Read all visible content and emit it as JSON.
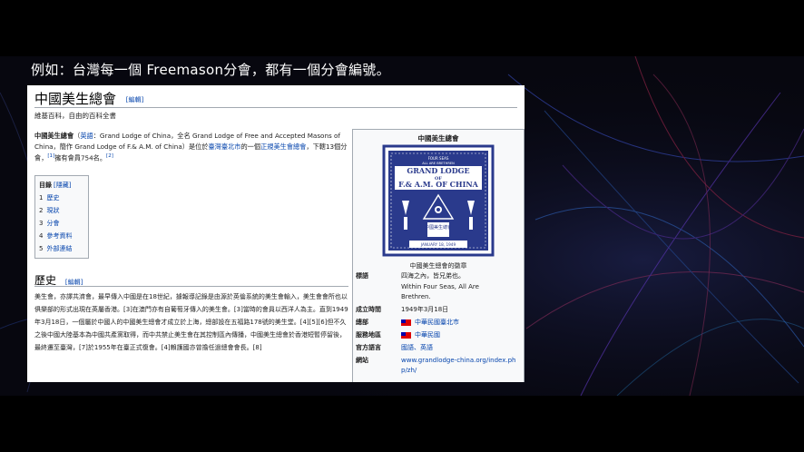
{
  "slide": {
    "caption": "例如：台灣每一個 Freemason分會，都有一個分會編號。"
  },
  "article": {
    "title": "中國美生總會",
    "title_edit": "[編輯]",
    "from": "維基百科，自由的百科全書",
    "intro_bold": "中國美生總會",
    "intro_parts": [
      "（",
      "英語",
      "：Grand Lodge of China，全名 Grand Lodge of Free and Accepted Masons of China，簡作 Grand Lodge of F.& A.M. of China）是位於",
      "臺灣臺北市",
      "的一個",
      "正規美生會總會",
      "，下轄13個分會，",
      "[1]",
      "擁有會員754名。",
      "[2]"
    ],
    "toc": {
      "title": "目錄",
      "hide": "[隱藏]",
      "items": [
        {
          "num": "1",
          "label": "歷史"
        },
        {
          "num": "2",
          "label": "現狀"
        },
        {
          "num": "3",
          "label": "分會"
        },
        {
          "num": "4",
          "label": "參考資料"
        },
        {
          "num": "5",
          "label": "外部連結"
        }
      ]
    },
    "history_heading": "歷史",
    "history_edit": "[編輯]",
    "history_text": "美生會，亦譯共濟會，最早傳入中國是在18世紀，據報導記錄是由源於英倫系統的美生會輸入，美生會會所也以俱樂部的形式出現在英屬香港。[3]在澳門亦有自葡萄牙傳入的美生會。[3]當時的會員以西洋人為主。直到1949年3月18日，一個屬於中國人的中國美生總會才成立於上海，總部設在五福路178號的美生堂。[4][5][6]但不久之後中國大陸基本為中國共產黨取得，而中共禁止美生會在其控制區內傳播，中國美生總會於香港短暫停留後，最終遷至臺灣，[7]於1955年在臺正式復會。[4]賴護國亦曾擔任過總會會長。[8]"
  },
  "infobox": {
    "caption": "中國美生總會",
    "emblem": {
      "top_text": "FOUR SEAS",
      "top_text2": "ALL ARE BRETHREN",
      "main1": "GRAND LODGE",
      "main2": "OF",
      "main3": "F.& A.M. OF CHINA",
      "chinese": "中國美生總會",
      "date": "JANUARY 18, 1949"
    },
    "emblem_caption": "中國美生總會的徽章",
    "rows": [
      {
        "key": "標語",
        "value": "四海之內，皆兄弟也。"
      },
      {
        "key": "",
        "value": "Within Four Seas, All Are Brethren."
      },
      {
        "key": "成立時間",
        "value": "1949年3月18日"
      },
      {
        "key": "總部",
        "value": "中華民國臺北市"
      },
      {
        "key": "服務地區",
        "value": "中華民國"
      },
      {
        "key": "官方語言",
        "value": "國語、英語"
      },
      {
        "key": "網站",
        "value": "www.grandlodge-china.org/index.php/zh/"
      }
    ]
  },
  "colors": {
    "link": "#0645ad",
    "slide_bg": "#000000",
    "emblem": "#2a3a8c"
  }
}
